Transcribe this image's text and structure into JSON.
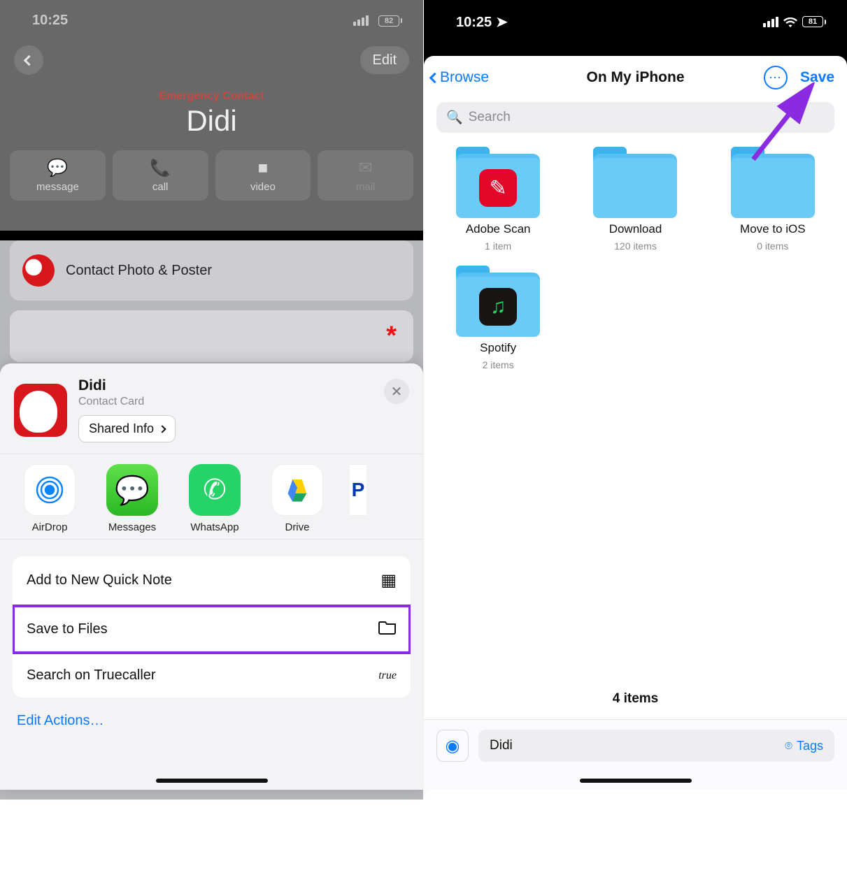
{
  "phone1": {
    "status": {
      "time": "10:25",
      "battery": "82"
    },
    "nav": {
      "edit": "Edit"
    },
    "emergency_label": "Emergency Contact",
    "contact_name": "Didi",
    "actions": {
      "message": "message",
      "call": "call",
      "video": "video",
      "mail": "mail"
    },
    "card_photo_poster": "Contact Photo & Poster",
    "share": {
      "title": "Didi",
      "subtitle": "Contact Card",
      "shared_info": "Shared Info",
      "apps": {
        "airdrop": "AirDrop",
        "messages": "Messages",
        "whatsapp": "WhatsApp",
        "drive": "Drive"
      },
      "rows": {
        "quick_note": "Add to New Quick Note",
        "save_files": "Save to Files",
        "truecaller": "Search on Truecaller"
      },
      "edit_actions": "Edit Actions…"
    }
  },
  "phone2": {
    "status": {
      "time": "10:25",
      "battery": "81"
    },
    "nav": {
      "back": "Browse",
      "title": "On My iPhone",
      "save": "Save"
    },
    "search_placeholder": "Search",
    "folders": [
      {
        "name": "Adobe Scan",
        "sub": "1 item",
        "app": "adobe"
      },
      {
        "name": "Download",
        "sub": "120 items",
        "app": ""
      },
      {
        "name": "Move to iOS",
        "sub": "0 items",
        "app": ""
      },
      {
        "name": "Spotify",
        "sub": "2 items",
        "app": "spotify"
      }
    ],
    "items_count": "4 items",
    "filename": "Didi",
    "tags_label": "Tags"
  }
}
